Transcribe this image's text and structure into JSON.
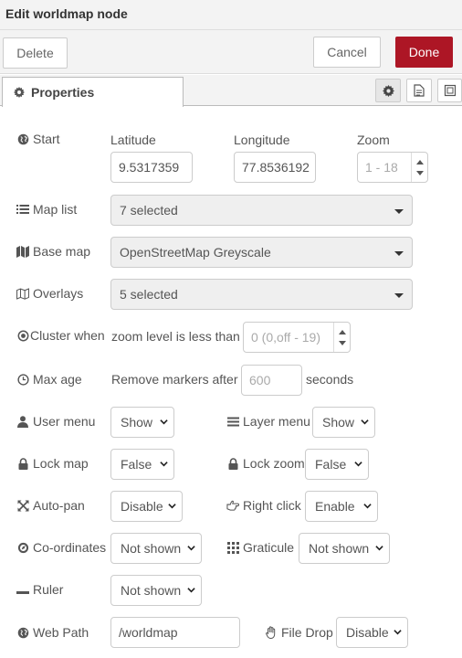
{
  "dialog": {
    "title": "Edit worldmap node"
  },
  "toolbar": {
    "delete_label": "Delete",
    "cancel_label": "Cancel",
    "done_label": "Done"
  },
  "tabs": {
    "properties_label": "Properties"
  },
  "colors": {
    "done_bg": "#ad1625",
    "toolbar_bg": "#f3f3f3"
  },
  "start": {
    "label": "Start",
    "latitude_label": "Latitude",
    "latitude_value": "9.5317359",
    "longitude_label": "Longitude",
    "longitude_value": "77.8536192",
    "zoom_label": "Zoom",
    "zoom_placeholder": "1 - 18"
  },
  "maplist": {
    "label": "Map list",
    "value": "7 selected"
  },
  "basemap": {
    "label": "Base map",
    "value": "OpenStreetMap Greyscale"
  },
  "overlays": {
    "label": "Overlays",
    "value": "5 selected"
  },
  "cluster": {
    "label": "Cluster when",
    "text": "zoom level is less than",
    "placeholder": "0 (0,off - 19)"
  },
  "maxage": {
    "label": "Max age",
    "prefix": "Remove markers after",
    "placeholder": "600",
    "suffix": "seconds"
  },
  "usermenu": {
    "label": "User menu",
    "value": "Show"
  },
  "layermenu": {
    "label": "Layer menu",
    "value": "Show"
  },
  "lockmap": {
    "label": "Lock map",
    "value": "False"
  },
  "lockzoom": {
    "label": "Lock zoom",
    "value": "False"
  },
  "autopan": {
    "label": "Auto-pan",
    "value": "Disable"
  },
  "rightclick": {
    "label": "Right click",
    "value": "Enable"
  },
  "coords": {
    "label": "Co-ordinates",
    "value": "Not shown"
  },
  "graticule": {
    "label": "Graticule",
    "value": "Not shown"
  },
  "ruler": {
    "label": "Ruler",
    "value": "Not shown"
  },
  "webpath": {
    "label": "Web Path",
    "value": "/worldmap"
  },
  "filedrop": {
    "label": "File Drop",
    "value": "Disable"
  }
}
